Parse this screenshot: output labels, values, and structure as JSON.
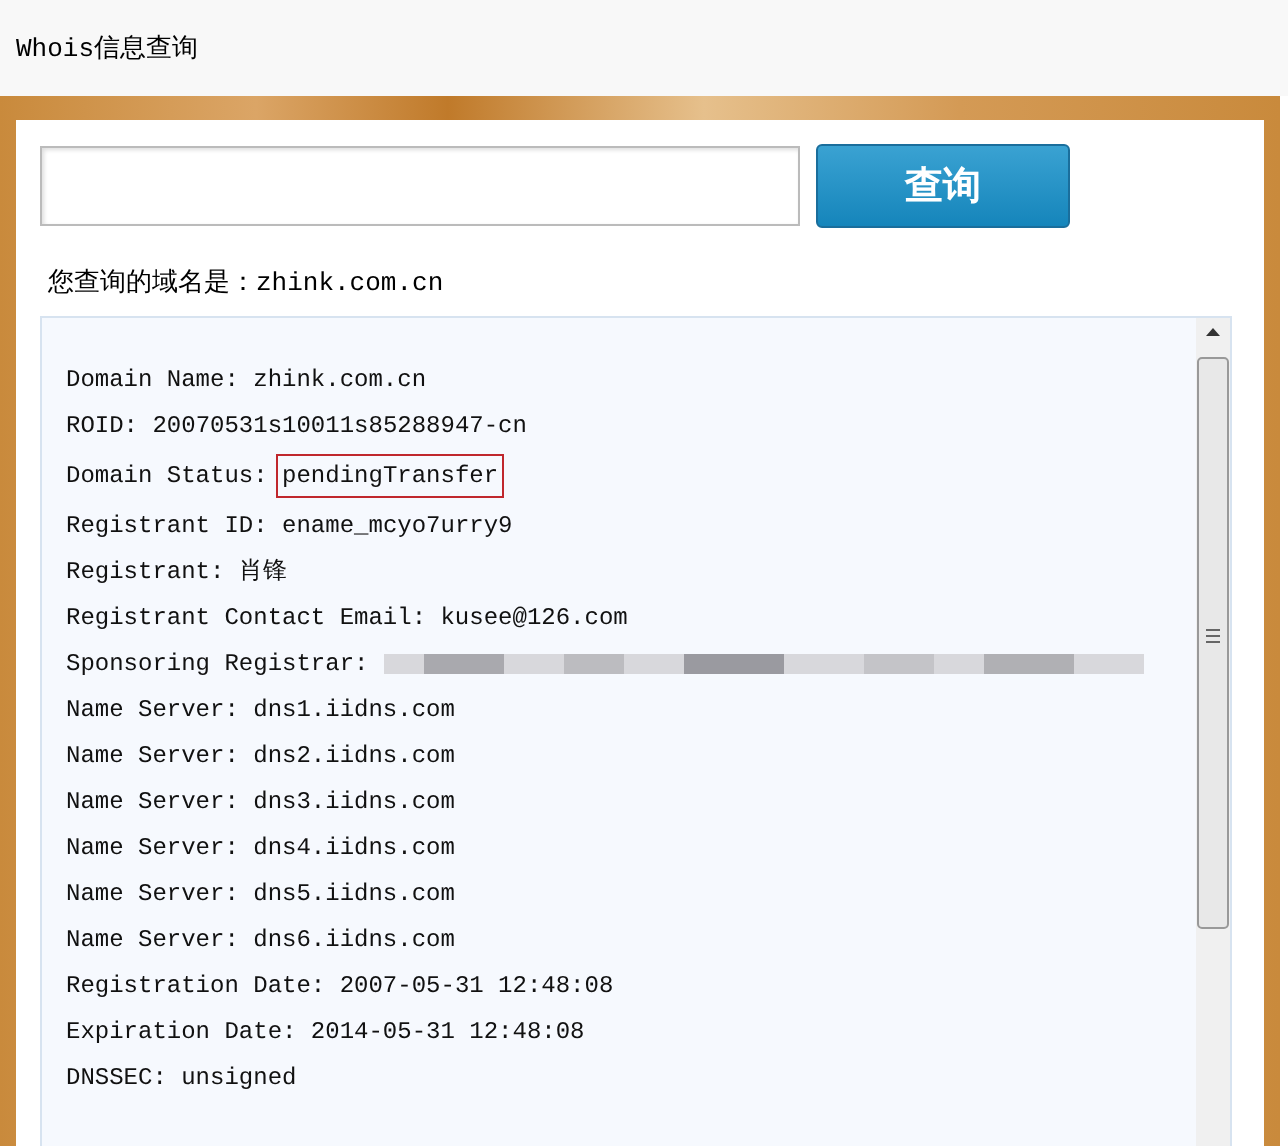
{
  "window": {
    "title": "Whois信息查询"
  },
  "search": {
    "button": "查询"
  },
  "query_label": "您查询的域名是：zhink.com.cn",
  "result_lines": [
    {
      "kind": "text",
      "label": "Domain Name:",
      "value": "zhink.com.cn",
      "highlighted": false
    },
    {
      "kind": "text",
      "label": "ROID:",
      "value": "20070531s10011s85288947-cn",
      "highlighted": false
    },
    {
      "kind": "text",
      "label": "Domain Status:",
      "value": "pendingTransfer",
      "highlighted": true
    },
    {
      "kind": "text",
      "label": "Registrant ID:",
      "value": "ename_mcyo7urry9",
      "highlighted": false
    },
    {
      "kind": "text",
      "label": "Registrant:",
      "value": "肖锋",
      "highlighted": false
    },
    {
      "kind": "text",
      "label": "Registrant Contact Email:",
      "value": "kusee@126.com",
      "highlighted": false
    },
    {
      "kind": "redacted",
      "label": "Sponsoring Registrar:"
    },
    {
      "kind": "text",
      "label": "Name Server:",
      "value": "dns1.iidns.com",
      "highlighted": false
    },
    {
      "kind": "text",
      "label": "Name Server:",
      "value": "dns2.iidns.com",
      "highlighted": false
    },
    {
      "kind": "text",
      "label": "Name Server:",
      "value": "dns3.iidns.com",
      "highlighted": false
    },
    {
      "kind": "text",
      "label": "Name Server:",
      "value": "dns4.iidns.com",
      "highlighted": false
    },
    {
      "kind": "text",
      "label": "Name Server:",
      "value": "dns5.iidns.com",
      "highlighted": false
    },
    {
      "kind": "text",
      "label": "Name Server:",
      "value": "dns6.iidns.com",
      "highlighted": false
    },
    {
      "kind": "text",
      "label": "Registration Date:",
      "value": "2007-05-31 12:48:08",
      "highlighted": false
    },
    {
      "kind": "text",
      "label": "Expiration Date:",
      "value": "2014-05-31 12:48:08",
      "highlighted": false
    },
    {
      "kind": "text",
      "label": "DNSSEC:",
      "value": "unsigned",
      "highlighted": false
    }
  ]
}
